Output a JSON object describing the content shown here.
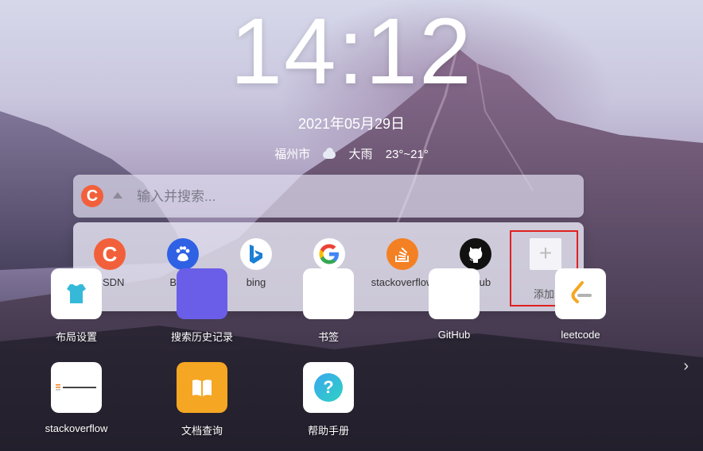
{
  "clock": "14:12",
  "date": "2021年05月29日",
  "weather": {
    "city": "福州市",
    "condition": "大雨",
    "temps": "23°~21°"
  },
  "search": {
    "placeholder": "输入并搜索..."
  },
  "engines": [
    {
      "label": "CSDN",
      "icon": "csdn-icon",
      "color": "#f2603b"
    },
    {
      "label": "Baidu",
      "icon": "baidu-icon",
      "color": "#2f61e4"
    },
    {
      "label": "bing",
      "icon": "bing-icon",
      "color": "#1f8ad6"
    },
    {
      "label": "google",
      "icon": "google-icon",
      "color": "#4285f4"
    },
    {
      "label": "stackoverflow",
      "icon": "stackoverflow-icon",
      "color": "#f48024"
    },
    {
      "label": "Github",
      "icon": "github-icon",
      "color": "#111111"
    }
  ],
  "add_label": "添加",
  "tiles": [
    {
      "label": "布局设置"
    },
    {
      "label": "搜索历史记录"
    },
    {
      "label": "书签"
    },
    {
      "label": "GitHub"
    },
    {
      "label": "leetcode"
    },
    {
      "label": "stackoverflow"
    },
    {
      "label": "文档查询"
    },
    {
      "label": "帮助手册"
    }
  ]
}
